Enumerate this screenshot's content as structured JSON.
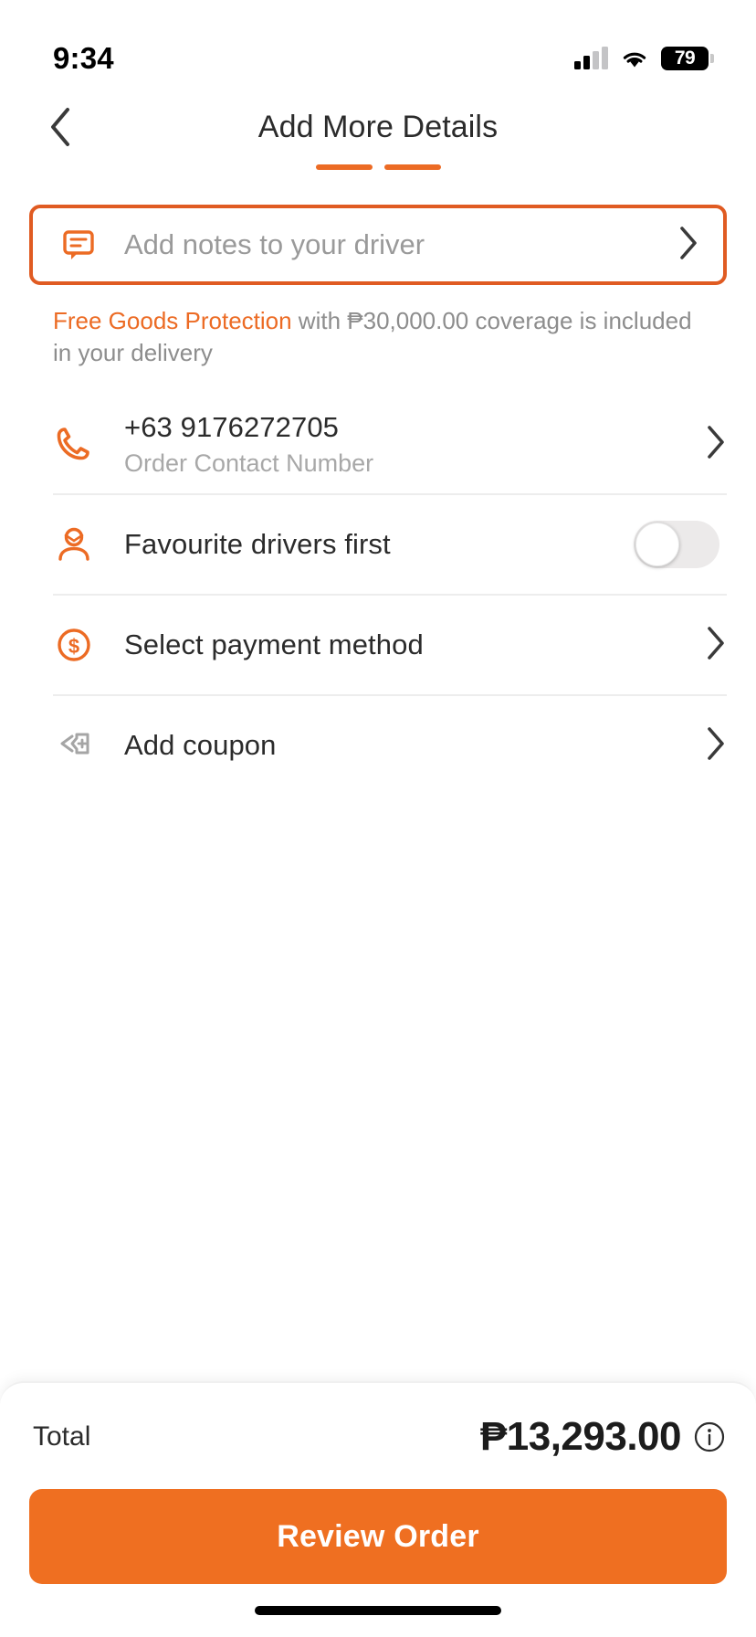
{
  "status_bar": {
    "time": "9:34",
    "battery_level": "79",
    "signal_icon": "cellular-signal-icon",
    "wifi_icon": "wifi-icon",
    "battery_icon": "battery-icon"
  },
  "header": {
    "title": "Add More Details",
    "back_icon": "chevron-left-icon",
    "progress_steps": 2
  },
  "notes": {
    "icon": "message-note-icon",
    "placeholder": "Add notes to your driver",
    "chevron_icon": "chevron-right-icon"
  },
  "protection": {
    "highlight": "Free Goods Protection",
    "rest": " with ₱30,000.00 coverage is included in your delivery"
  },
  "list": {
    "items": [
      {
        "name": "order-contact-number",
        "icon": "phone-icon",
        "title": "+63 9176272705",
        "subtitle": "Order Contact Number",
        "accessory": "chevron"
      },
      {
        "name": "favourite-drivers-first",
        "icon": "user-star-icon",
        "title": "Favourite drivers first",
        "subtitle": "",
        "accessory": "toggle",
        "toggle_on": false
      },
      {
        "name": "select-payment-method",
        "icon": "dollar-coin-icon",
        "title": "Select payment method",
        "subtitle": "",
        "accessory": "chevron"
      },
      {
        "name": "add-coupon",
        "icon": "coupon-add-icon",
        "title": "Add coupon",
        "subtitle": "",
        "accessory": "chevron"
      }
    ]
  },
  "footer": {
    "total_label": "Total",
    "total_amount": "₱13,293.00",
    "info_icon": "info-circle-icon",
    "cta_label": "Review Order"
  },
  "colors": {
    "accent": "#ec6b24",
    "cta": "#ef6f21",
    "border_active": "#e05b22",
    "text_primary": "#2b2b2b",
    "text_muted": "#9a9a9a"
  }
}
